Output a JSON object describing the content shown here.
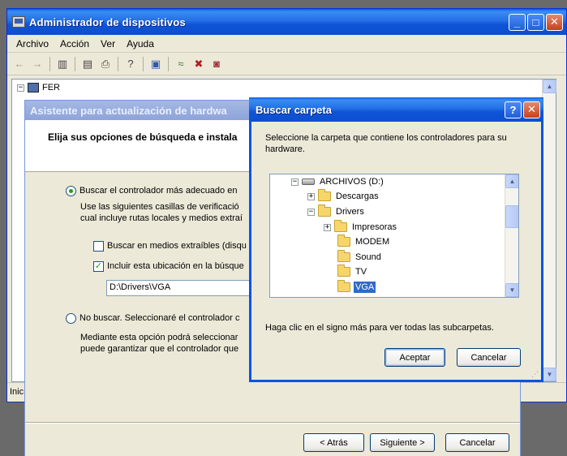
{
  "device_manager": {
    "title": "Administrador de dispositivos",
    "menu": [
      "Archivo",
      "Acción",
      "Ver",
      "Ayuda"
    ],
    "tree_root": "FER",
    "status_text": "Inic"
  },
  "wizard": {
    "title": "Asistente para actualización de hardwa",
    "header": "Elija sus opciones de búsqueda e instala",
    "option_search_label": "Buscar el controlador más adecuado en",
    "option_search_desc_1": "Use las siguientes casillas de verificació",
    "option_search_desc_2": "cual incluye rutas locales y medios extraí",
    "check_removable_label": "Buscar en medios extraíbles (disqu",
    "check_include_location_label": "Incluir esta ubicación en la búsque",
    "location_value": "D:\\Drivers\\VGA",
    "option_nosearch_label": "No buscar. Seleccionaré el controlador c",
    "option_nosearch_desc_1": "Mediante esta opción podrá seleccionar",
    "option_nosearch_desc_2": "puede garantizar que el controlador que",
    "back_label": "< Atrás",
    "next_label": "Siguiente >",
    "cancel_label": "Cancelar"
  },
  "browse": {
    "title": "Buscar carpeta",
    "help_label": "?",
    "description": "Seleccione la carpeta que contiene los controladores para su hardware.",
    "tree": [
      {
        "label": "ARCHIVOS (D:)",
        "level": 0,
        "expander": "−",
        "icon": "drive-icon"
      },
      {
        "label": "Descargas",
        "level": 1,
        "expander": "+",
        "icon": "folder-icon"
      },
      {
        "label": "Drivers",
        "level": 1,
        "expander": "−",
        "icon": "folder-icon"
      },
      {
        "label": "Impresoras",
        "level": 2,
        "expander": "+",
        "icon": "folder-icon"
      },
      {
        "label": "MODEM",
        "level": 2,
        "expander": "",
        "icon": "folder-icon"
      },
      {
        "label": "Sound",
        "level": 2,
        "expander": "",
        "icon": "folder-icon"
      },
      {
        "label": "TV",
        "level": 2,
        "expander": "",
        "icon": "folder-icon"
      },
      {
        "label": "VGA",
        "level": 2,
        "expander": "",
        "icon": "folder-open-icon",
        "selected": true
      }
    ],
    "hint": "Haga clic en el signo más para ver todas las subcarpetas.",
    "accept_label": "Aceptar",
    "cancel_label": "Cancelar"
  },
  "colors": {
    "title_bar_blue": "#0c4fd0",
    "selection_blue": "#316ac5",
    "dialog_face": "#ece9d8"
  }
}
